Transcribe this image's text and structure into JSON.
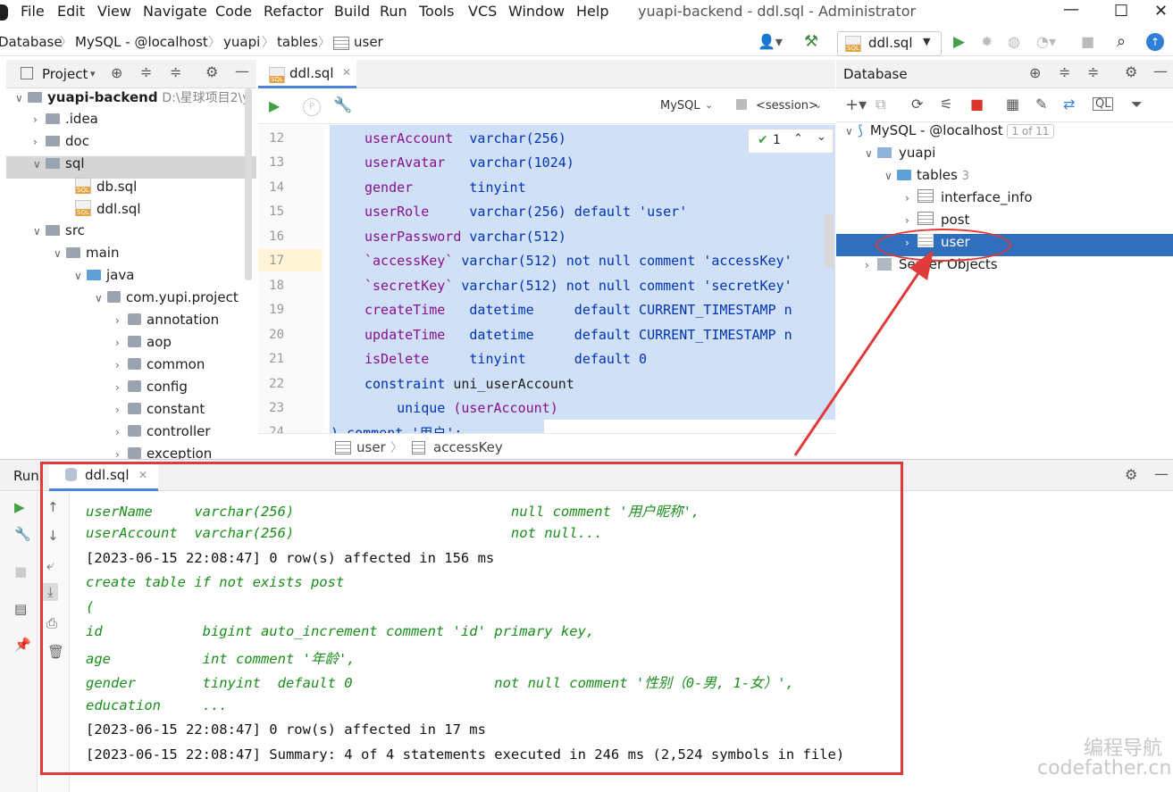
{
  "menubar": {
    "items": [
      "File",
      "Edit",
      "View",
      "Navigate",
      "Code",
      "Refactor",
      "Build",
      "Run",
      "Tools",
      "VCS",
      "Window",
      "Help"
    ],
    "window_title": "yuapi-backend - ddl.sql - Administrator"
  },
  "navbar": {
    "crumbs": [
      "Database",
      "MySQL - @localhost",
      "yuapi",
      "tables",
      "user"
    ],
    "run_config": "ddl.sql"
  },
  "project": {
    "tab_label": "Project",
    "root_name": "yuapi-backend",
    "root_path": "D:\\星球项目2\\y",
    "items": [
      ".idea",
      "doc",
      "sql",
      "db.sql",
      "ddl.sql",
      "src",
      "main",
      "java",
      "com.yupi.project",
      "annotation",
      "aop",
      "common",
      "config",
      "constant",
      "controller",
      "exception"
    ]
  },
  "editor": {
    "tab_label": "ddl.sql",
    "dialect": "MySQL",
    "session": "<session>",
    "inspection_count": "1",
    "line_numbers": [
      "12",
      "13",
      "14",
      "15",
      "16",
      "17",
      "18",
      "19",
      "20",
      "21",
      "22",
      "23",
      "24"
    ],
    "lines": [
      [
        "userAccount  ",
        "varchar(256)"
      ],
      [
        "userAvatar   ",
        "varchar(1024)"
      ],
      [
        "gender       ",
        "tinyint"
      ],
      [
        "userRole     ",
        "varchar(256) default 'user'"
      ],
      [
        "userPassword ",
        "varchar(512)"
      ],
      [
        "`accessKey` ",
        "varchar(512) not null comment 'accessKey'"
      ],
      [
        "`secretKey` ",
        "varchar(512) not null comment 'secretKey'"
      ],
      [
        "createTime   ",
        "datetime     default CURRENT_TIMESTAMP n"
      ],
      [
        "updateTime   ",
        "datetime     default CURRENT_TIMESTAMP n"
      ],
      [
        "isDelete     ",
        "tinyint      default 0"
      ],
      [
        "constraint ",
        "uni_userAccount"
      ],
      [
        "    unique ",
        "(userAccount)"
      ],
      [
        ") comment '用户';",
        ""
      ]
    ],
    "breadcrumb": [
      "user",
      "accessKey"
    ]
  },
  "database": {
    "title": "Database",
    "connection": "MySQL - @localhost",
    "connection_badge": "1 of 11",
    "schema": "yuapi",
    "tables_label": "tables",
    "tables_count": "3",
    "tables": [
      "interface_info",
      "post",
      "user"
    ],
    "server_objects": "Server Objects"
  },
  "run": {
    "label": "Run:",
    "tab_label": "ddl.sql",
    "lines": [
      {
        "text": "userName     varchar(256)                          null comment '用户昵称',",
        "style": "green"
      },
      {
        "text": "userAccount  varchar(256)                          not null...",
        "style": "green"
      },
      {
        "text": "[2023-06-15 22:08:47] 0 row(s) affected in 156 ms",
        "style": "plain"
      },
      {
        "text": "create table if not exists post",
        "style": "green"
      },
      {
        "text": "(",
        "style": "green"
      },
      {
        "text": "id            bigint auto_increment comment 'id' primary key,",
        "style": "green"
      },
      {
        "text": "age           int comment '年龄',",
        "style": "green"
      },
      {
        "text": "gender        tinyint  default 0                 not null comment '性别（0-男, 1-女）',",
        "style": "green"
      },
      {
        "text": "education     ...",
        "style": "green"
      },
      {
        "text": "[2023-06-15 22:08:47] 0 row(s) affected in 17 ms",
        "style": "plain"
      },
      {
        "text": "[2023-06-15 22:08:47] Summary: 4 of 4 statements executed in 246 ms (2,524 symbols in file)",
        "style": "plain"
      }
    ]
  },
  "watermark": {
    "line1": "编程导航",
    "line2": "codefather.cn"
  },
  "colors": {
    "selection": "#cfe0f7",
    "tree_selected": "#2f6fbd",
    "highlight_red": "#e03a3a",
    "output_green": "#1a8f1a"
  }
}
